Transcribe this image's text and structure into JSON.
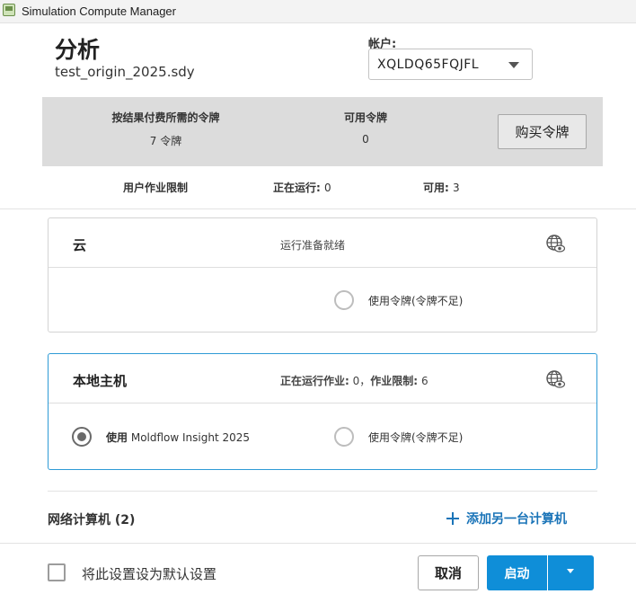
{
  "window": {
    "title": "Simulation Compute Manager"
  },
  "header": {
    "title": "分析",
    "file_name": "test_origin_2025.sdy",
    "account_label": "帐户:",
    "account_value": "XQLDQ65FQJFL"
  },
  "tokens": {
    "required_label": "按结果付费所需的令牌",
    "required_value": "7 令牌",
    "available_label": "可用令牌",
    "available_value": "0",
    "buy_label": "购买令牌"
  },
  "job_limits": {
    "label": "用户作业限制",
    "running_label": "正在运行:",
    "running_value": "0",
    "available_label": "可用:",
    "available_value": "3"
  },
  "cloud": {
    "title": "云",
    "status": "运行准备就绪",
    "icon": "globe-eye-icon",
    "option_tokens_label": "使用令牌(令牌不足)"
  },
  "local": {
    "title": "本地主机",
    "status_running_label": "正在运行作业:",
    "status_running_value": "0",
    "status_limit_label": "作业限制:",
    "status_limit_value": "6",
    "icon": "globe-eye-icon",
    "option_license_prefix": "使用",
    "option_license_product": "Moldflow Insight 2025",
    "option_tokens_label": "使用令牌(令牌不足)"
  },
  "network": {
    "label": "网络计算机 (2)",
    "add_label": "添加另一台计算机"
  },
  "footer": {
    "default_label": "将此设置设为默认设置",
    "cancel_label": "取消",
    "start_label": "启动"
  },
  "colors": {
    "accent": "#0f8ed8",
    "link": "#1a74b8",
    "band": "#dcdcdc",
    "selected_border": "#2e9bd6"
  }
}
